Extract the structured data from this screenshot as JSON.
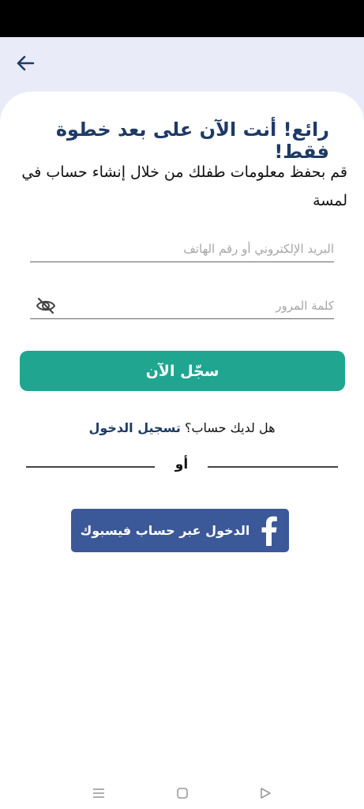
{
  "header": {
    "back_icon": "arrow-left-icon"
  },
  "title": "رائع! أنت الآن على بعد خطوة فقط!",
  "subtitle": "قم بحفظ معلومات طفلك من خلال إنشاء حساب في لمسة",
  "form": {
    "email_placeholder": "البريد الإلكتروني أو رقم الهاتف",
    "password_placeholder": "كلمة المرور",
    "password_visibility_icon": "eye-off-icon"
  },
  "register_label": "سجّل الآن",
  "login_prompt": "هل لديك حساب؟",
  "login_link": "تسجيل الدخول",
  "or_label": "أو",
  "facebook": {
    "label": "الدخول عبر حساب فيسبوك",
    "icon": "facebook-icon"
  },
  "nav": {
    "menu_icon": "menu-icon",
    "home_icon": "home-square-icon",
    "back_icon": "back-triangle-icon"
  },
  "colors": {
    "primary": "#1fa590",
    "title": "#1e3a66",
    "facebook": "#3b5898",
    "header_bg": "#e9ecf8"
  }
}
